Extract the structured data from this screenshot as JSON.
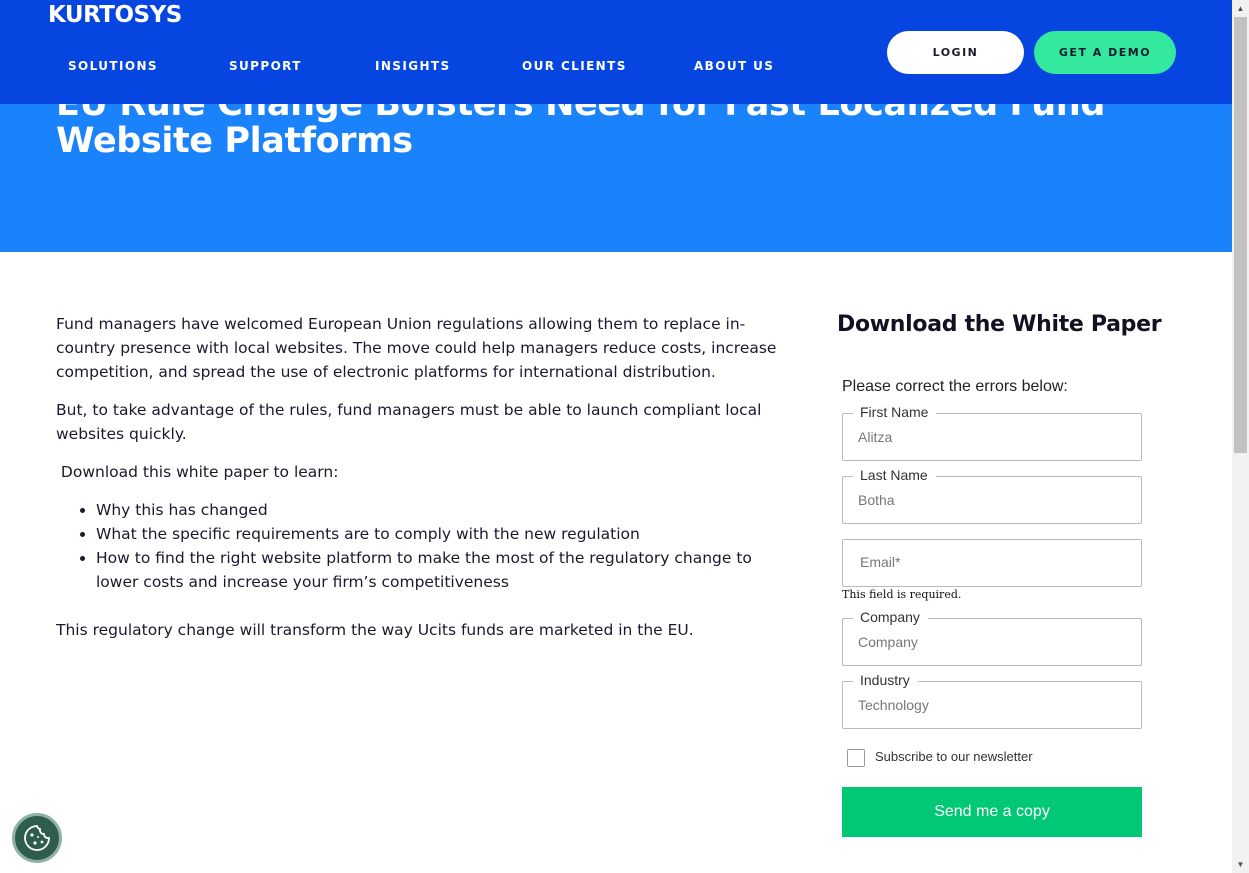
{
  "brand": {
    "logo_text": "KURTOSYS"
  },
  "nav": {
    "items": [
      "SOLUTIONS",
      "SUPPORT",
      "INSIGHTS",
      "OUR CLIENTS",
      "ABOUT US"
    ],
    "login_label": "LOGIN",
    "demo_label": "GET A DEMO"
  },
  "hero": {
    "title": "EU Rule Change Bolsters Need for Fast Localized Fund Website Platforms"
  },
  "article": {
    "paragraph_1": "Fund managers have welcomed European Union regulations allowing them to replace in-country presence with local websites. The move could help managers reduce costs, increase competition, and spread the use of electronic platforms for international distribution.",
    "paragraph_2": "But, to take advantage of the rules, fund managers must be able to launch compliant local websites quickly.",
    "list_intro": " Download this white paper to learn:",
    "bullets": [
      "Why this has changed",
      "What the specific requirements are to comply with the new regulation",
      "How to find the right website platform to make the most of the regulatory change to lower costs and increase your firm’s competitiveness"
    ],
    "closing": "This regulatory change will transform the way Ucits funds are marketed in the EU."
  },
  "form": {
    "title": "Download the White Paper",
    "error_message": "Please correct the errors below:",
    "first_name": {
      "label": "First Name",
      "value": "Alitza"
    },
    "last_name": {
      "label": "Last Name",
      "value": "Botha"
    },
    "email": {
      "placeholder": "Email*",
      "hint": "This field is required."
    },
    "company": {
      "label": "Company",
      "placeholder": "Company"
    },
    "industry": {
      "label": "Industry",
      "value": "Technology"
    },
    "newsletter_label": "Subscribe to our newsletter",
    "newsletter_checked": false,
    "submit_label": "Send me a copy"
  },
  "colors": {
    "header_bg": "#0645e0",
    "hero_bg": "#1a82fb",
    "demo_button": "#34e89e",
    "submit_button": "#00c875",
    "cookie_button": "#2f5d4b"
  },
  "icons": {
    "cookie": "cookie-icon",
    "scroll_up": "scroll-up-arrow-icon",
    "scroll_down": "scroll-down-arrow-icon"
  }
}
